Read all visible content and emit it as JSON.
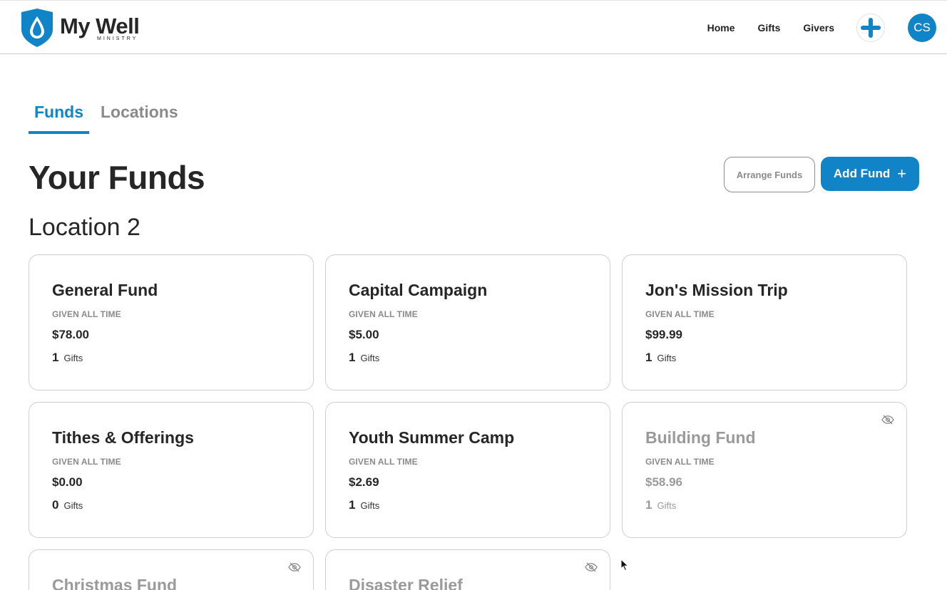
{
  "brand": {
    "title": "My Well",
    "subtitle": "MINISTRY",
    "color": "#1183c7"
  },
  "nav": {
    "home": "Home",
    "gifts": "Gifts",
    "givers": "Givers",
    "avatar_initials": "CS"
  },
  "tabs": [
    {
      "label": "Funds",
      "active": true
    },
    {
      "label": "Locations",
      "active": false
    }
  ],
  "page": {
    "title": "Your Funds",
    "arrange_label": "Arrange Funds",
    "add_label": "Add Fund",
    "add_icon": "+"
  },
  "location": {
    "name": "Location 2"
  },
  "given_label": "GIVEN ALL TIME",
  "gifts_label": "Gifts",
  "funds": [
    {
      "name": "General Fund",
      "amount": "$78.00",
      "gifts": "1",
      "hidden": false
    },
    {
      "name": "Capital Campaign",
      "amount": "$5.00",
      "gifts": "1",
      "hidden": false
    },
    {
      "name": "Jon's Mission Trip",
      "amount": "$99.99",
      "gifts": "1",
      "hidden": false
    },
    {
      "name": "Tithes & Offerings",
      "amount": "$0.00",
      "gifts": "0",
      "hidden": false
    },
    {
      "name": "Youth Summer Camp",
      "amount": "$2.69",
      "gifts": "1",
      "hidden": false
    },
    {
      "name": "Building Fund",
      "amount": "$58.96",
      "gifts": "1",
      "hidden": true
    },
    {
      "name": "Christmas Fund",
      "hidden": true
    },
    {
      "name": "Disaster Relief",
      "hidden": true
    }
  ]
}
